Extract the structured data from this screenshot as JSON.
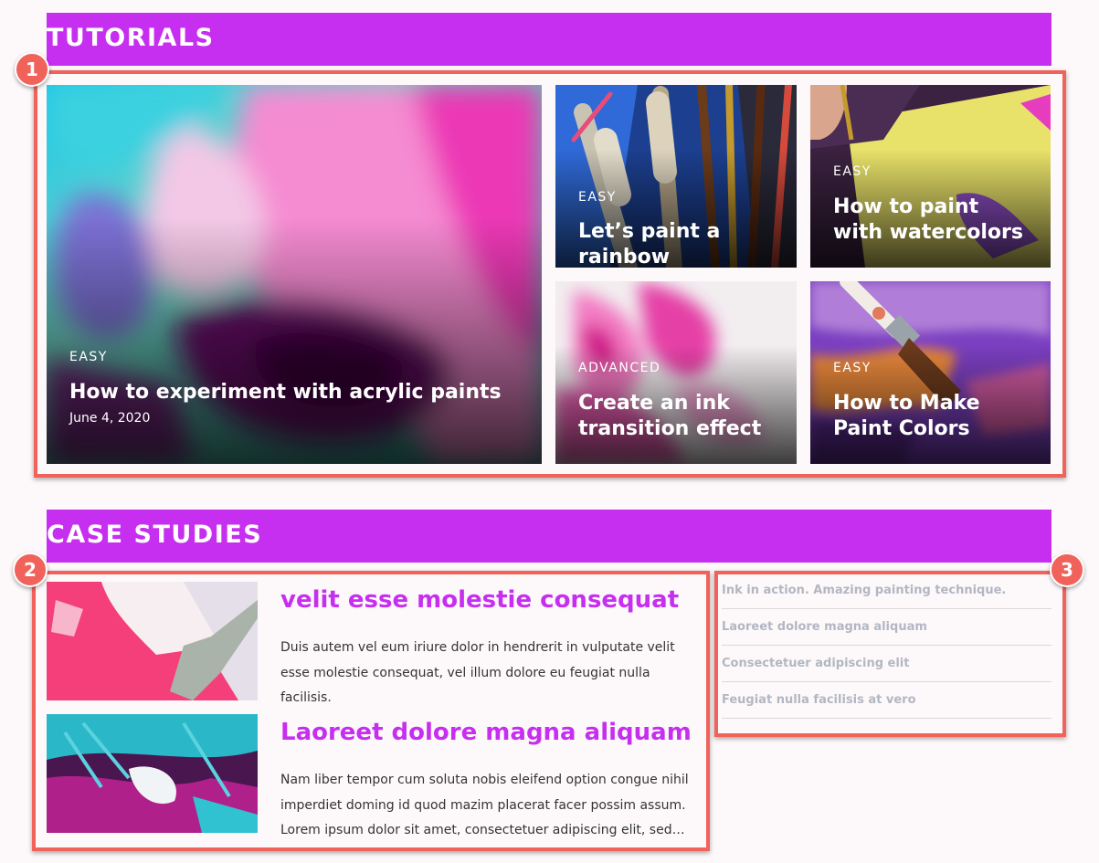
{
  "sections": {
    "tutorials_title": "TUTORIALS",
    "case_studies_title": "CASE STUDIES"
  },
  "annotations": [
    "1",
    "2",
    "3"
  ],
  "tutorials": [
    {
      "level": "EASY",
      "title": "How to experiment with acrylic paints",
      "date": "June 4, 2020"
    },
    {
      "level": "EASY",
      "title": "Let’s paint a rainbow"
    },
    {
      "level": "EASY",
      "title": "How to paint with watercolors"
    },
    {
      "level": "ADVANCED",
      "title": "Create an ink transition effect"
    },
    {
      "level": "EASY",
      "title": "How to Make Paint Colors"
    }
  ],
  "case_studies": [
    {
      "title": "velit esse molestie consequat",
      "text": "Duis autem vel eum iriure dolor in hendrerit in vulputate velit esse molestie consequat, vel illum dolore eu feugiat nulla facilisis."
    },
    {
      "title": "Laoreet dolore magna aliquam",
      "text": "Nam liber tempor cum soluta nobis eleifend option congue nihil imperdiet doming id quod mazim placerat facer possim assum. Lorem ipsum dolor sit amet, consectetuer adipiscing elit, sed diam nonummy nibh euismod tincidunt ut laoreet dolore magna aliquam erat volutpat."
    }
  ],
  "sidebar_links": [
    "Ink in action. Amazing painting technique.",
    "Laoreet dolore magna aliquam",
    "Consectetuer adipiscing elit",
    "Feugiat nulla facilisis at vero"
  ],
  "colors": {
    "accent": "#c62ef0",
    "annotation": "#f0625a",
    "sidebar_text": "#b2b7c2"
  }
}
